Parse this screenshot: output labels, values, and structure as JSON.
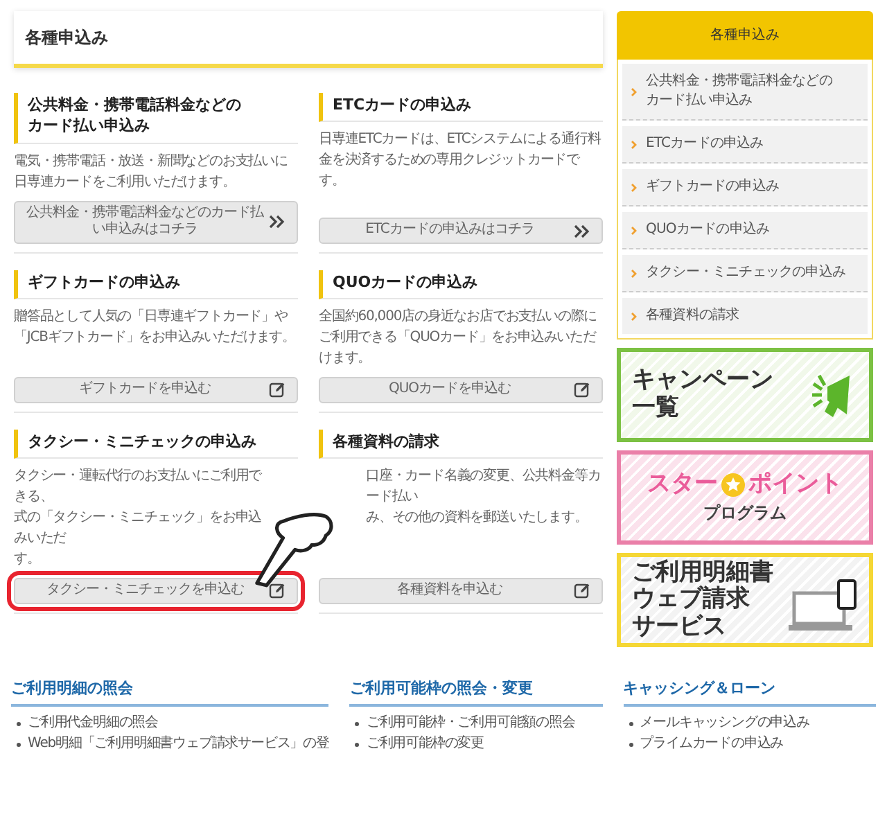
{
  "header": {
    "title": "各種申込み"
  },
  "cards": [
    {
      "title_lines": [
        "公共料金・携帯電話料金などの",
        "カード払い申込み"
      ],
      "description": [
        {
          "text": "電気・携帯電話・放送・新聞などのお支払いに日専連カードをご利用いただけます。"
        }
      ],
      "button": {
        "label": "公共料金・携帯電話料金などのカード払い申込みはコチラ",
        "kind": "link",
        "highlighted": false
      }
    },
    {
      "title_lines": [
        "ETCカードの申込み"
      ],
      "description": [
        {
          "text": "日専連ETCカードは、ETCシステムによる通行料金を決済するための専用クレジットカードです。"
        }
      ],
      "button": {
        "label": "ETCカードの申込みはコチラ",
        "kind": "link",
        "highlighted": false
      }
    },
    {
      "title_lines": [
        "ギフトカードの申込み"
      ],
      "description": [
        {
          "text": "贈答品として人気の「日専連ギフトカード」や「JCBギフトカード」をお申込みいただけます。"
        }
      ],
      "button": {
        "label": "ギフトカードを申込む",
        "kind": "apply",
        "highlighted": false
      }
    },
    {
      "title_lines": [
        "QUOカードの申込み"
      ],
      "description": [
        {
          "text": "全国約60,000店の身近なお店でお支払いの際にご利用できる「QUOカード」をお申込みいただけます。"
        }
      ],
      "button": {
        "label": "QUOカードを申込む",
        "kind": "apply",
        "highlighted": false
      }
    },
    {
      "title_lines": [
        "タクシー・ミニチェックの申込み"
      ],
      "description": [
        {
          "text": "タクシー・運転代行のお支払いにご利用できる、",
          "hidden_end": true
        },
        {
          "text": "式の「タクシー・ミニチェック」をお申込みいただ",
          "hidden_end": true
        },
        {
          "text": "す。"
        }
      ],
      "button": {
        "label": "タクシー・ミニチェックを申込む",
        "kind": "apply",
        "highlighted": true
      }
    },
    {
      "title_lines": [
        "各種資料の請求"
      ],
      "description": [
        {
          "text": "口座・カード名義の変更、公共料金等カード払い",
          "hidden_start": true
        },
        {
          "text": "み、その他の資料を郵送いたします。",
          "hidden_start": true
        }
      ],
      "button": {
        "label": "各種資料を申込む",
        "kind": "apply",
        "highlighted": false
      }
    }
  ],
  "sidebar": {
    "title": "各種申込み",
    "items": [
      {
        "lines": [
          "公共料金・携帯電話料金などの",
          "カード払い申込み"
        ]
      },
      {
        "lines": [
          "ETCカードの申込み"
        ]
      },
      {
        "lines": [
          "ギフトカードの申込み"
        ]
      },
      {
        "lines": [
          "QUOカードの申込み"
        ]
      },
      {
        "lines": [
          "タクシー・ミニチェックの申込み"
        ]
      },
      {
        "lines": [
          "各種資料の請求"
        ]
      }
    ]
  },
  "banners": [
    {
      "kind": "campaign",
      "lines": [
        "キャンペーン",
        "一覧"
      ]
    },
    {
      "kind": "star",
      "lines": [
        "スター",
        "ポイント",
        "プログラム"
      ]
    },
    {
      "kind": "statement",
      "lines": [
        "ご利用明細書",
        "ウェブ請求",
        "サービス"
      ]
    }
  ],
  "footer": [
    {
      "title": "ご利用明細の照会",
      "items": [
        "ご利用代金明細の照会",
        "Web明細「ご利用明細書ウェブ請求サービス」の登"
      ]
    },
    {
      "title": "ご利用可能枠の照会・変更",
      "items": [
        "ご利用可能枠・ご利用可能額の照会",
        "ご利用可能枠の変更"
      ]
    },
    {
      "title": "キャッシング＆ローン",
      "items": [
        "メールキャッシングの申込み",
        "プライムカードの申込み"
      ]
    }
  ]
}
